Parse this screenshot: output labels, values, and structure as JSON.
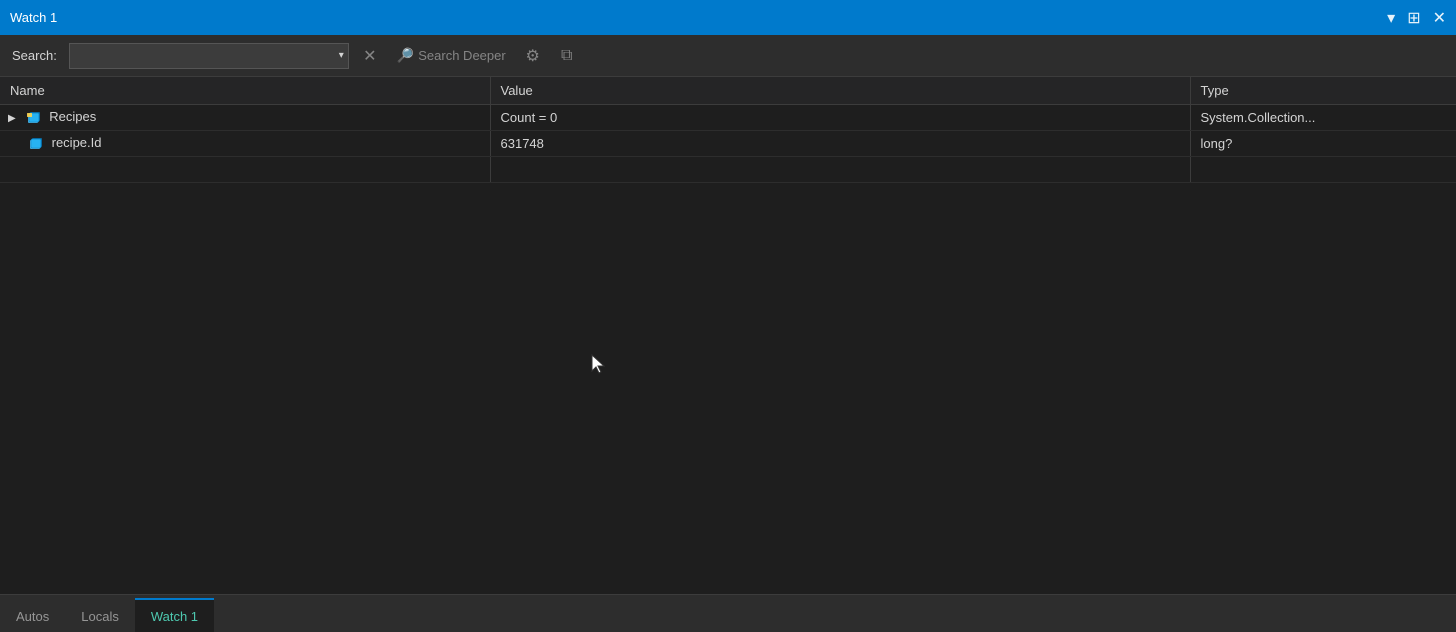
{
  "titleBar": {
    "title": "Watch 1",
    "dropdownIcon": "▾",
    "pinIcon": "⊞",
    "closeIcon": "✕"
  },
  "toolbar": {
    "searchLabel": "Search:",
    "searchPlaceholder": "",
    "searchValue": "",
    "dropdownArrow": "▾",
    "clearIcon": "✕",
    "searchDeeperLabel": "Search Deeper",
    "settingsIcon": "⚙",
    "collapseIcon": "⧉"
  },
  "table": {
    "columns": [
      {
        "id": "name",
        "label": "Name"
      },
      {
        "id": "value",
        "label": "Value"
      },
      {
        "id": "type",
        "label": "Type"
      }
    ],
    "rows": [
      {
        "id": "recipes",
        "indent": 0,
        "expandable": true,
        "name": "Recipes",
        "value": "Count = 0",
        "type": "System.Collection..."
      },
      {
        "id": "recipe-id",
        "indent": 1,
        "expandable": false,
        "name": "recipe.Id",
        "value": "631748",
        "type": "long?"
      },
      {
        "id": "empty",
        "indent": 0,
        "expandable": false,
        "name": "",
        "value": "",
        "type": ""
      }
    ]
  },
  "tabs": [
    {
      "id": "autos",
      "label": "Autos",
      "active": false
    },
    {
      "id": "locals",
      "label": "Locals",
      "active": false
    },
    {
      "id": "watch1",
      "label": "Watch 1",
      "active": true
    }
  ],
  "colors": {
    "accent": "#007acc",
    "titleBg": "#007acc",
    "toolbarBg": "#2d2d2d",
    "mainBg": "#1e1e1e",
    "tableBg": "#252526",
    "activeTab": "#4ec9b0"
  }
}
